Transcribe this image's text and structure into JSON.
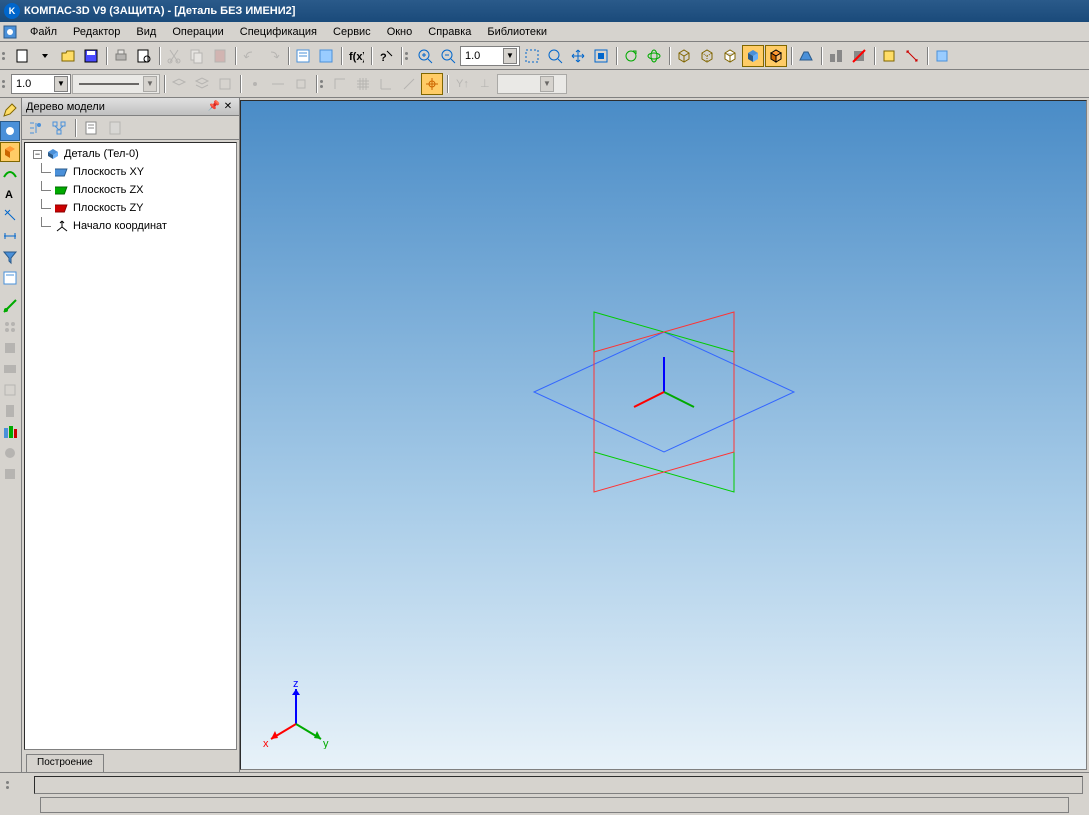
{
  "title": "КОМПАС-3D V9 (ЗАЩИТА) - [Деталь БЕЗ ИМЕНИ2]",
  "menu": [
    "Файл",
    "Редактор",
    "Вид",
    "Операции",
    "Спецификация",
    "Сервис",
    "Окно",
    "Справка",
    "Библиотеки"
  ],
  "toolbar1_zoom": "1.0",
  "toolbar2_combo1": "1.0",
  "toolbar2_combo2": "",
  "tree": {
    "title": "Дерево модели",
    "root": "Деталь (Тел-0)",
    "items": [
      "Плоскость XY",
      "Плоскость ZX",
      "Плоскость ZY",
      "Начало координат"
    ]
  },
  "tree_tab": "Построение",
  "axis_labels": {
    "x": "x",
    "y": "y",
    "z": "z"
  }
}
